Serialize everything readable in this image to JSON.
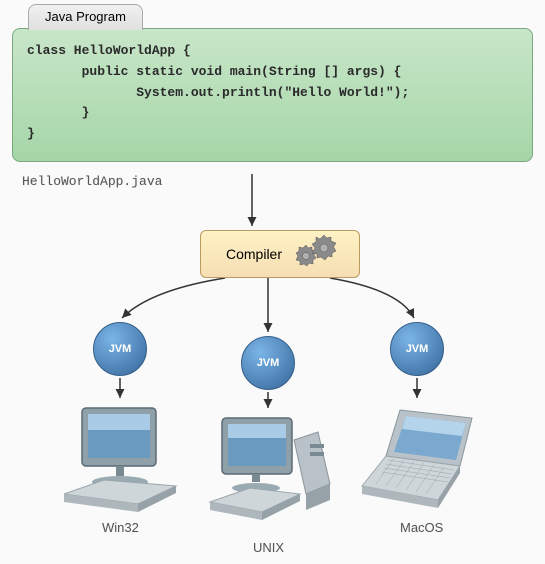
{
  "tab_title": "Java Program",
  "code": "class HelloWorldApp {\n       public static void main(String [] args) {\n              System.out.println(\"Hello World!\");\n       }\n}",
  "filename": "HelloWorldApp.java",
  "compiler_label": "Compiler",
  "jvm_label": "JVM",
  "platforms": {
    "p1": "Win32",
    "p2": "UNIX",
    "p3": "MacOS"
  }
}
